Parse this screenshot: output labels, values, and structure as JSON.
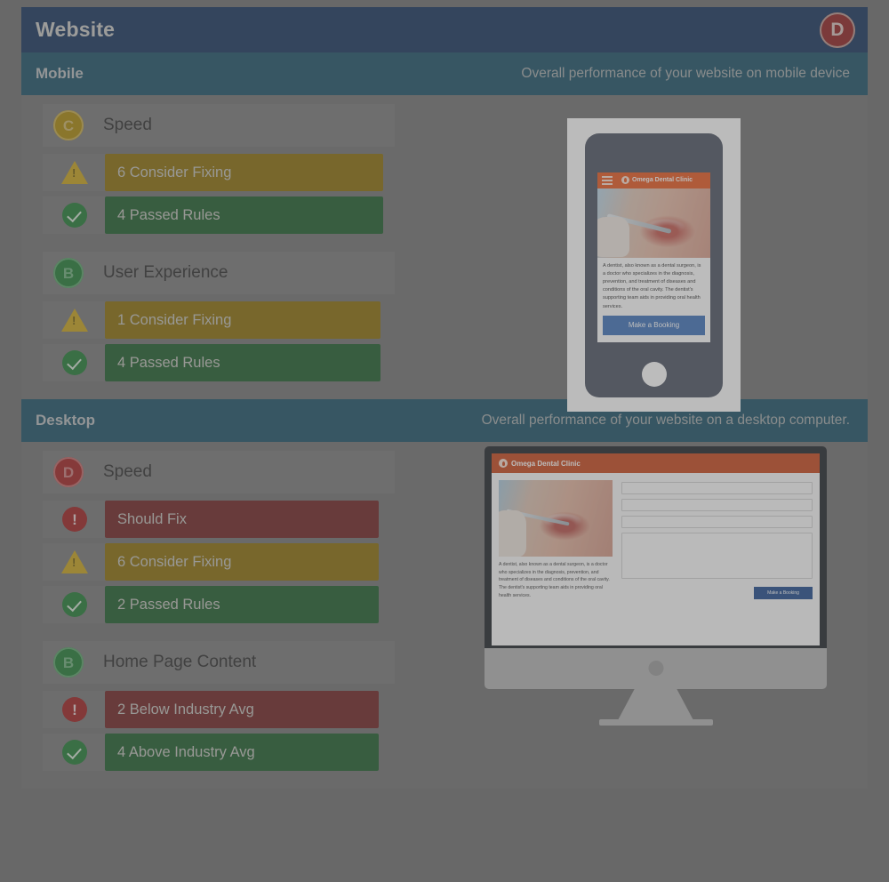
{
  "header": {
    "title": "Website",
    "grade": "D",
    "grade_color": "#8f2020"
  },
  "sections": [
    {
      "name": "Mobile",
      "description": "Overall performance of your website on mobile device",
      "groups": [
        {
          "title": "Speed",
          "grade": "C",
          "grade_class": "grade-c",
          "rows": [
            {
              "icon": "warning-icon",
              "label": "6 Consider Fixing",
              "bar_class": "bar-warn",
              "width_class": "bar-w-313",
              "color": "#8a6d08"
            },
            {
              "icon": "check-icon",
              "label": "4 Passed Rules",
              "bar_class": "bar-pass",
              "width_class": "bar-w-313",
              "color": "#1d5c2a"
            }
          ]
        },
        {
          "title": "User Experience",
          "grade": "B",
          "grade_class": "grade-b",
          "rows": [
            {
              "icon": "warning-icon",
              "label": "1 Consider Fixing",
              "bar_class": "bar-warn",
              "width_class": "bar-w-310",
              "color": "#8a6d08"
            },
            {
              "icon": "check-icon",
              "label": "4 Passed Rules",
              "bar_class": "bar-pass",
              "width_class": "bar-w-310",
              "color": "#1d5c2a"
            }
          ]
        }
      ]
    },
    {
      "name": "Desktop",
      "description": "Overall performance of your website on a desktop computer.",
      "groups": [
        {
          "title": "Speed",
          "grade": "D",
          "grade_class": "grade-d",
          "rows": [
            {
              "icon": "error-icon",
              "label": "Should Fix",
              "bar_class": "bar-error",
              "width_class": "bar-w-308",
              "color": "#6e2222"
            },
            {
              "icon": "warning-icon",
              "label": "6 Consider Fixing",
              "bar_class": "bar-warn",
              "width_class": "bar-w-308",
              "color": "#8a6d08"
            },
            {
              "icon": "check-icon",
              "label": "2 Passed Rules",
              "bar_class": "bar-pass",
              "width_class": "bar-w-308",
              "color": "#1d5c2a"
            }
          ]
        },
        {
          "title": "Home Page Content",
          "grade": "B",
          "grade_class": "grade-b",
          "rows": [
            {
              "icon": "error-icon",
              "label": "2 Below Industry Avg",
              "bar_class": "bar-error",
              "width_class": "bar-w-308",
              "color": "#6e2222"
            },
            {
              "icon": "check-icon",
              "label": "4 Above Industry Avg",
              "bar_class": "bar-pass",
              "width_class": "bar-w-308",
              "color": "#1d5c2a"
            }
          ]
        }
      ]
    }
  ],
  "mobile_preview": {
    "brand": "Omega Dental Clinic",
    "body_text": "A dentist, also known as a dental surgeon, is a doctor who specializes in the diagnosis, prevention, and treatment of diseases and conditions of the oral cavity. The dentist's supporting team aids in providing oral health services.",
    "cta": "Make a Booking"
  },
  "desktop_preview": {
    "brand": "Omega Dental Clinic",
    "body_text": "A dentist, also known as a dental surgeon, is a doctor who specializes in the diagnosis, prevention, and treatment of diseases and conditions of the oral cavity. The dentist's supporting team aids in providing oral health services.",
    "cta": "Make a Booking",
    "field_count": 3
  }
}
